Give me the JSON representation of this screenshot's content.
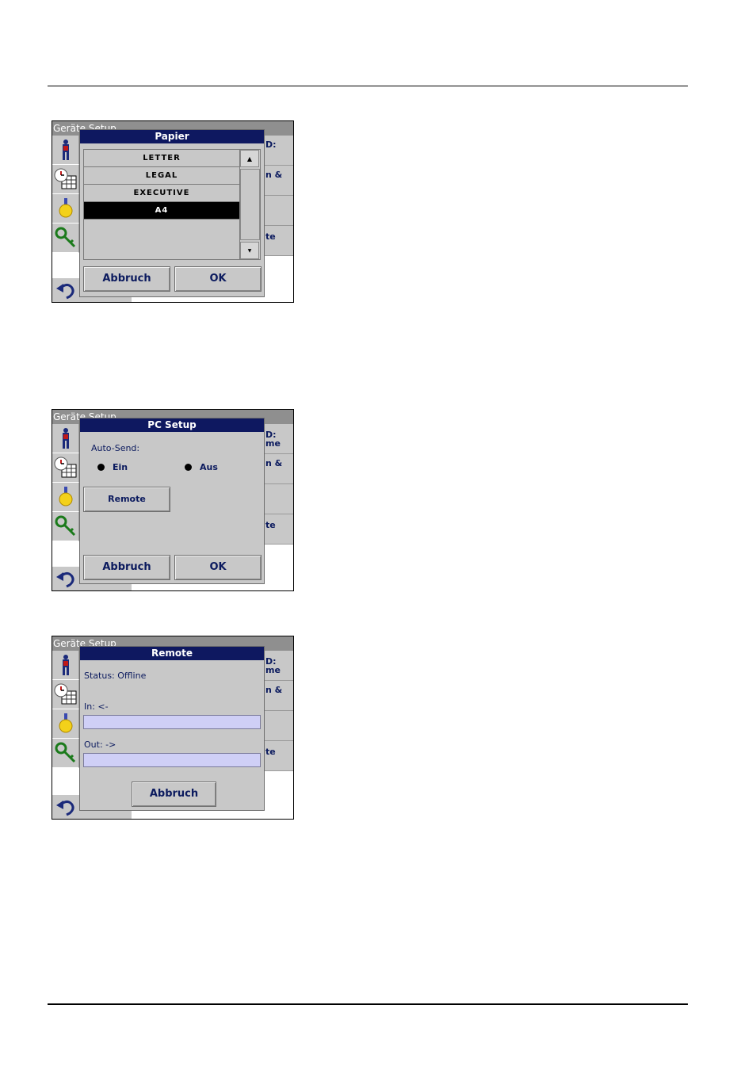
{
  "bg_title": "Geräte Setup",
  "bg_side": {
    "row1": "D:",
    "row1b": "me",
    "row2": "n &",
    "row4": "te"
  },
  "papier": {
    "title": "Papier",
    "items": [
      "LETTER",
      "LEGAL",
      "EXECUTIVE",
      "A4",
      ""
    ],
    "selected": "A4",
    "cancel": "Abbruch",
    "ok": "OK"
  },
  "pc_setup": {
    "title": "PC Setup",
    "auto_send_label": "Auto-Send:",
    "option_on": "Ein",
    "option_off": "Aus",
    "remote_button": "Remote",
    "cancel": "Abbruch",
    "ok": "OK"
  },
  "remote": {
    "title": "Remote",
    "status": "Status: Offline",
    "in_label": "In: <-",
    "out_label": "Out: ->",
    "cancel": "Abbruch"
  }
}
